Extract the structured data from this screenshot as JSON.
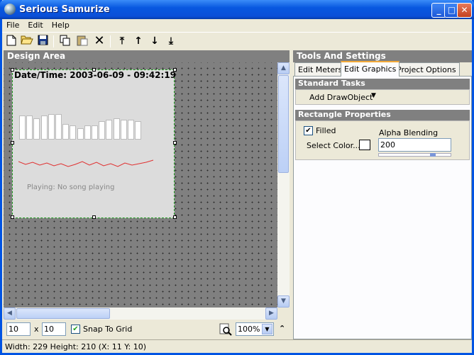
{
  "window": {
    "title": "Serious Samurize",
    "controls": [
      "_",
      "□",
      "✕"
    ]
  },
  "menu": [
    "File",
    "Edit",
    "Help"
  ],
  "toolbar": {
    "icons": [
      "new-icon",
      "open-icon",
      "save-icon",
      "copy-icon",
      "paste-icon",
      "delete-icon",
      "move-top-icon",
      "move-up-icon",
      "move-down-icon",
      "move-bottom-icon"
    ]
  },
  "design": {
    "header": "Design Area",
    "datetime": "Date/Time: 2003-06-09 - 09:42:19",
    "meter_values": [
      34,
      34,
      30,
      34,
      36,
      36,
      22,
      20,
      16,
      20,
      20,
      26,
      28,
      30,
      28,
      28,
      26
    ],
    "playing": "Playing: No song playing",
    "grid_x": "10",
    "grid_x_sep": "x",
    "grid_y": "10",
    "snap_label": "Snap To Grid",
    "snap_checked": true,
    "zoom": "100%"
  },
  "tools": {
    "header": "Tools And Settings",
    "tabs": [
      "Edit Meters",
      "Edit Graphics",
      "Project Options"
    ],
    "active_tab": 1,
    "standard_tasks": "Standard Tasks",
    "add_drawobject": "Add DrawObject",
    "rect_props": "Rectangle Properties",
    "filled_label": "Filled",
    "alpha_label": "Alpha Blending",
    "select_color": "Select Color...",
    "alpha_value": "200"
  },
  "status": {
    "text": "Width: 229  Height: 210  (X: 11  Y: 10)"
  },
  "colors": {
    "title_blue": "#0858e0",
    "grid_bg": "#808080",
    "canvas_border": "#1a9a1a",
    "line_red": "#e03030"
  }
}
